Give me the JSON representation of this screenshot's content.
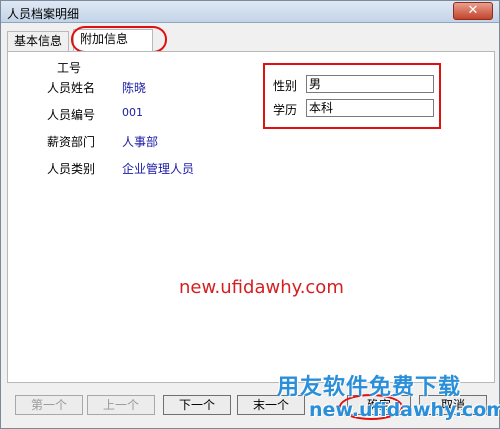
{
  "window": {
    "title": "人员档案明细",
    "close_glyph": "✕"
  },
  "tabs": [
    {
      "label": "基本信息"
    },
    {
      "label": "附加信息"
    }
  ],
  "form": {
    "employee_id_label": "工号",
    "fields": [
      {
        "label": "人员姓名",
        "value": "陈晓"
      },
      {
        "label": "人员编号",
        "value": "001"
      },
      {
        "label": "薪资部门",
        "value": "人事部"
      },
      {
        "label": "人员类别",
        "value": "企业管理人员"
      }
    ],
    "extra": [
      {
        "label": "性别",
        "value": "男"
      },
      {
        "label": "学历",
        "value": "本科"
      }
    ]
  },
  "watermark": "new.ufidawhy.com",
  "buttons": {
    "first": "第一个",
    "prev": "上一个",
    "next": "下一个",
    "last": "末一个",
    "ok": "确定",
    "cancel": "取消"
  },
  "brand": {
    "line1": "用友软件免费下载",
    "line2": "new.ufidawhy.com"
  },
  "colors": {
    "value_text": "#1a1aa6",
    "highlight_ring": "#e01010",
    "brand": "#2a8fd8"
  }
}
